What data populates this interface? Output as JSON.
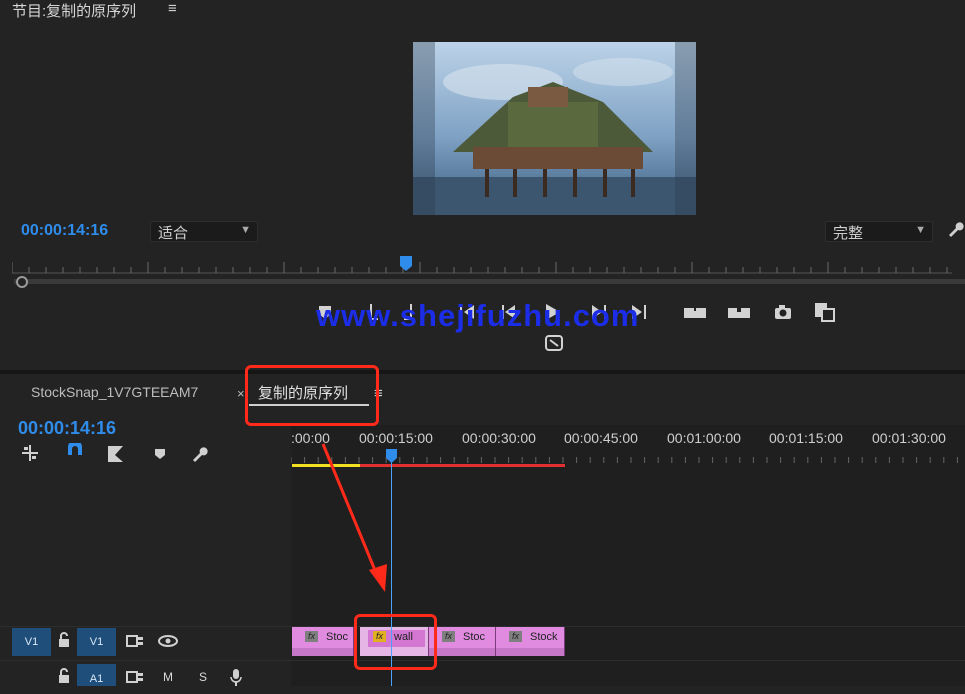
{
  "program": {
    "title": "节目:复制的原序列",
    "menu_icon": "≡",
    "timecode": "00:00:14:16",
    "fit_value": "适合",
    "quality_value": "完整"
  },
  "watermark": "www.shejifuzhu.com",
  "timeline": {
    "tabs": [
      {
        "label": "StockSnap_1V7GTEEAM7"
      },
      {
        "label": "复制的原序列",
        "active": true
      }
    ],
    "tab_close": "×",
    "menu_icon": "≡",
    "timecode": "00:00:14:16",
    "ruler_labels": [
      ":00:00",
      "00:00:15:00",
      "00:00:30:00",
      "00:00:45:00",
      "00:01:00:00",
      "00:01:15:00",
      "00:01:30:00"
    ],
    "tracks": {
      "v1": {
        "source": "V1",
        "target": "V1"
      },
      "a1": {
        "target": "A1",
        "mute": "M",
        "solo": "S"
      }
    },
    "clips": [
      {
        "fx": "fx",
        "name": "Stoc"
      },
      {
        "fx": "fx",
        "name": "wall"
      },
      {
        "fx": "fx",
        "name": "Stoc"
      },
      {
        "fx": "fx",
        "name": "Stock"
      }
    ]
  },
  "colors": {
    "accent_timecode": "#2f8ceb",
    "clip_pink": "#e08be0",
    "annotation_red": "#ff2a1a",
    "watermark_blue": "#1b2de6"
  }
}
